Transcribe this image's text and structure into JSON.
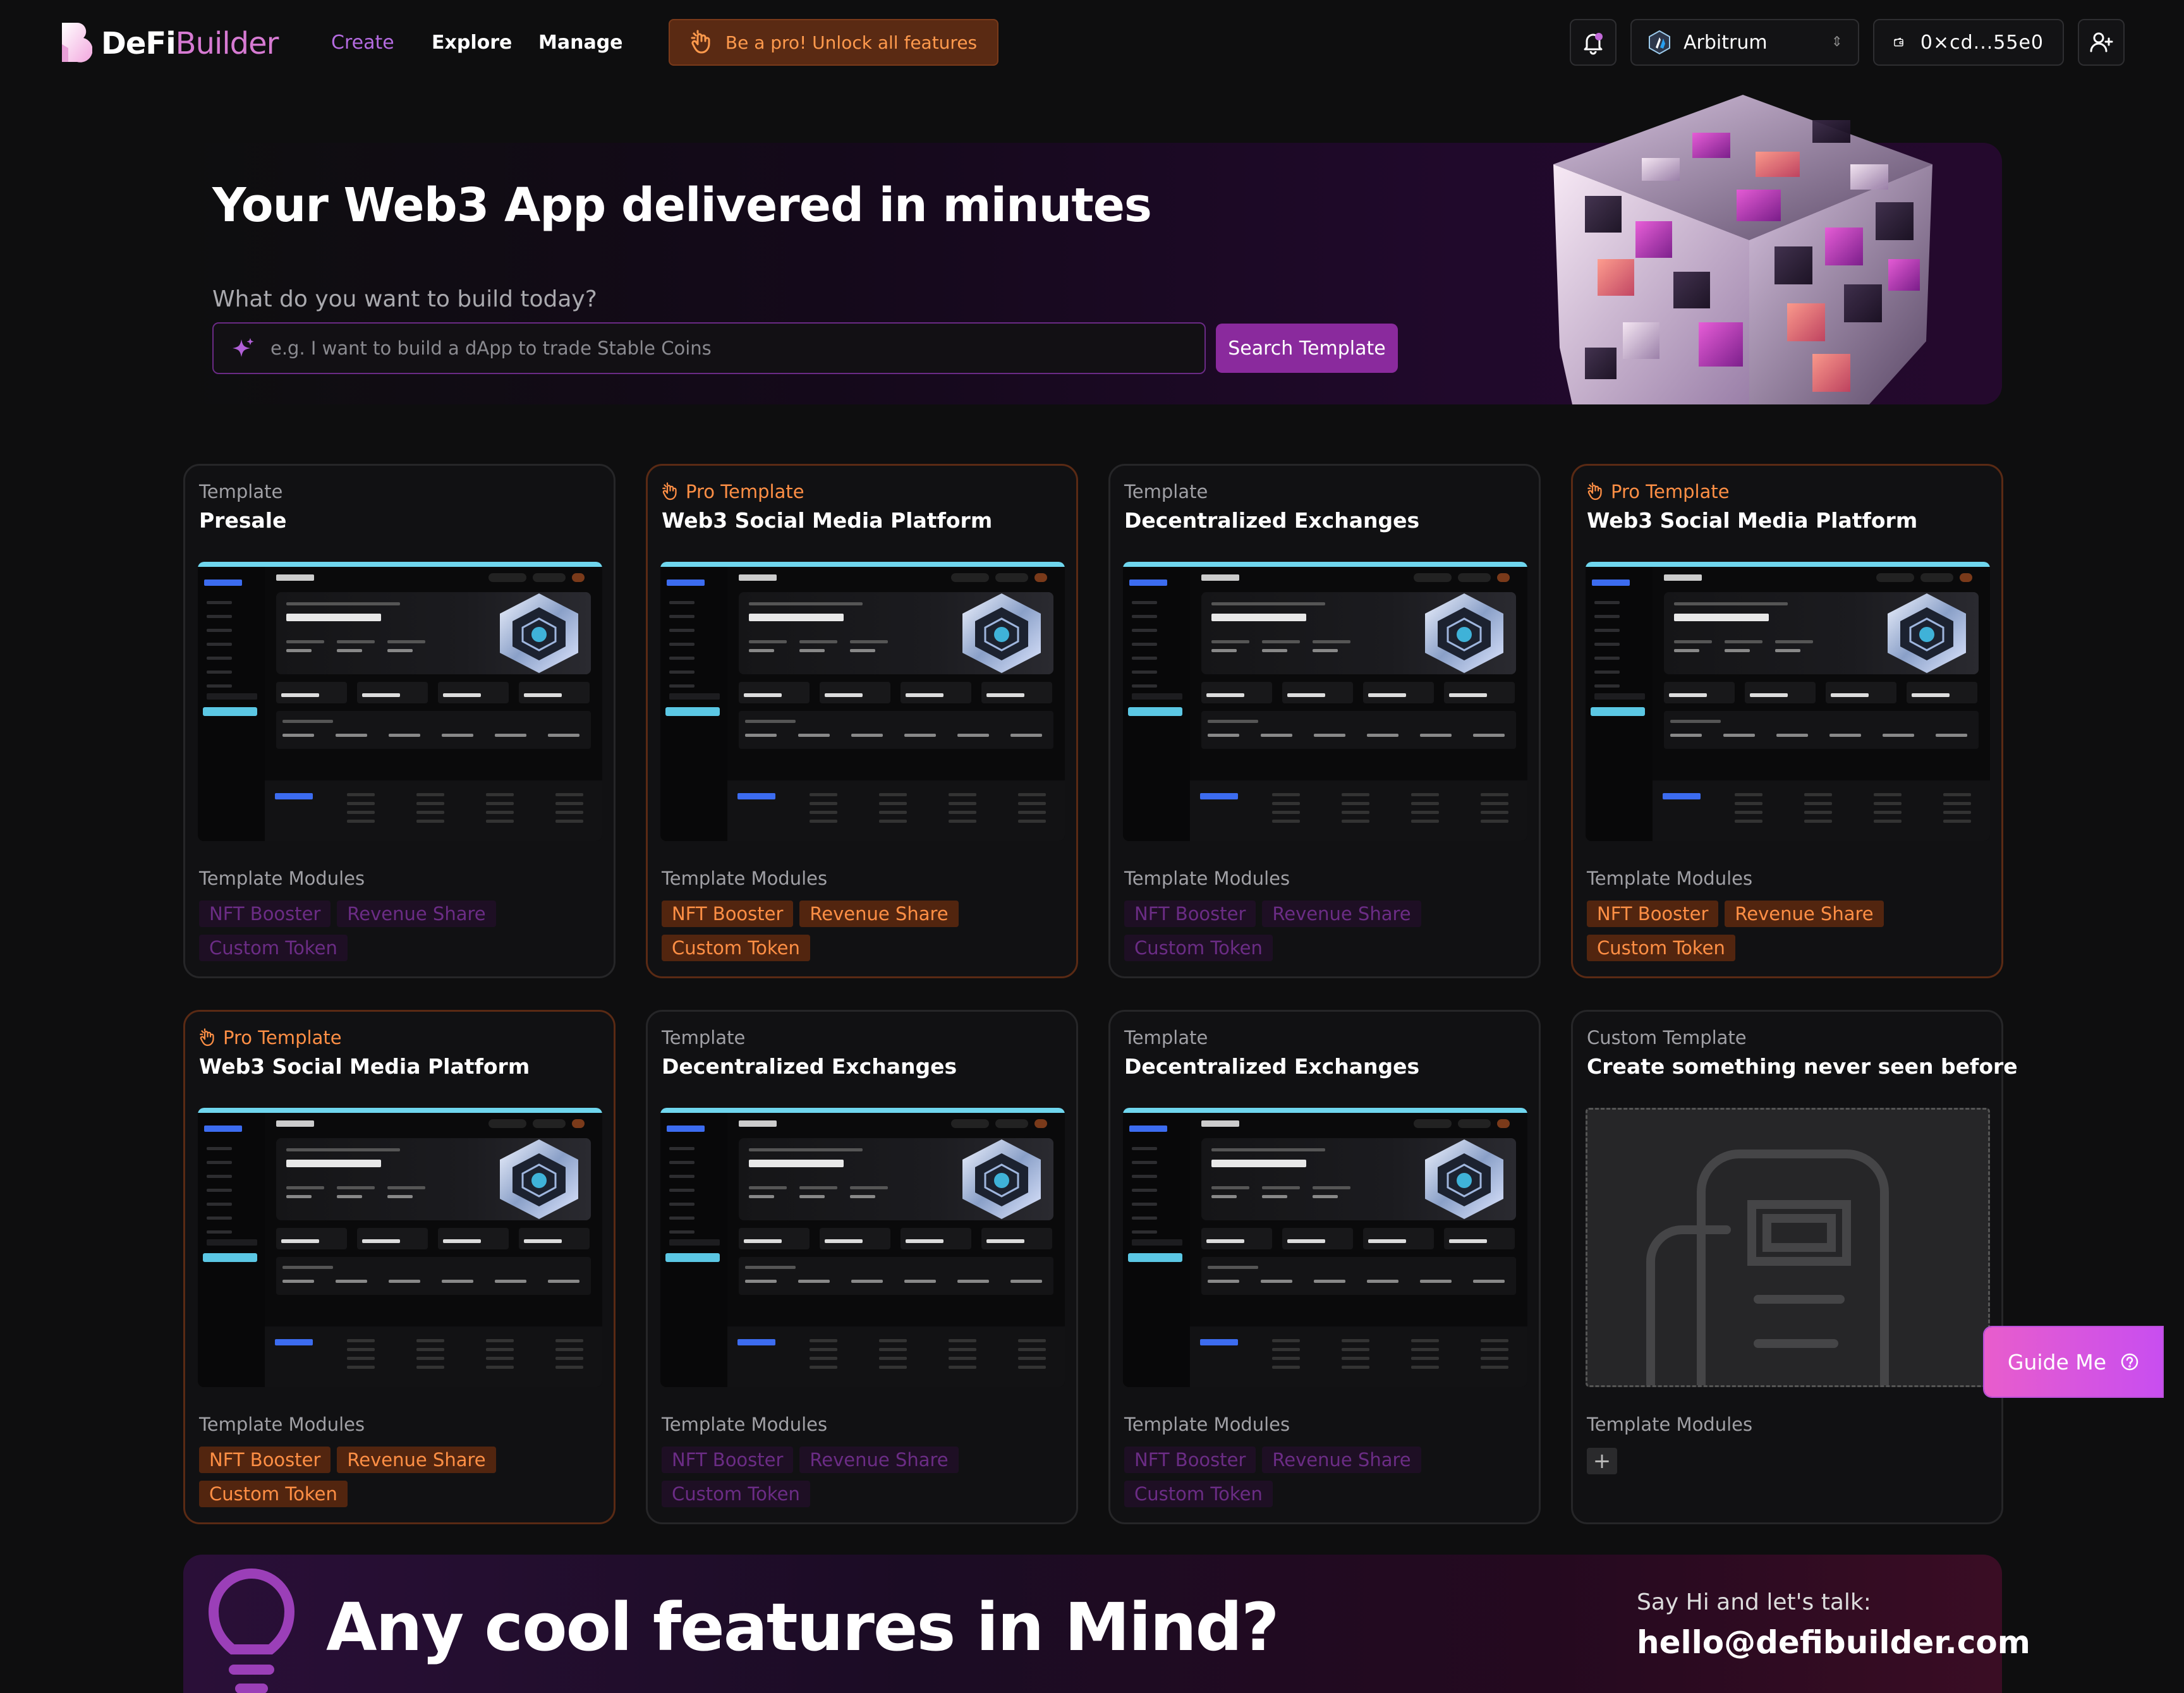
{
  "nav": {
    "logo_main": "DeFi",
    "logo_accent": "Builder",
    "links": [
      "Create",
      "Explore",
      "Manage"
    ],
    "pro_banner": "Be a pro! Unlock all features",
    "network": "Arbitrum",
    "wallet": "0×cd...55e0"
  },
  "hero": {
    "title": "Your Web3 App delivered in minutes",
    "subtitle": "What do you want to build today?",
    "search_placeholder": "e.g. I want to build a dApp to trade Stable Coins",
    "search_button": "Search Template"
  },
  "cards": [
    {
      "kind": "Template",
      "title": "Presale",
      "pro": false,
      "modules_label": "Template Modules",
      "tags": [
        "NFT Booster",
        "Revenue Share",
        "Custom Token"
      ]
    },
    {
      "kind": "Pro Template",
      "title": "Web3 Social Media Platform",
      "pro": true,
      "modules_label": "Template Modules",
      "tags": [
        "NFT Booster",
        "Revenue Share",
        "Custom Token"
      ]
    },
    {
      "kind": "Template",
      "title": "Decentralized Exchanges",
      "pro": false,
      "modules_label": "Template Modules",
      "tags": [
        "NFT Booster",
        "Revenue Share",
        "Custom Token"
      ]
    },
    {
      "kind": "Pro Template",
      "title": "Web3 Social Media Platform",
      "pro": true,
      "modules_label": "Template Modules",
      "tags": [
        "NFT Booster",
        "Revenue Share",
        "Custom Token"
      ]
    },
    {
      "kind": "Pro Template",
      "title": "Web3 Social Media Platform",
      "pro": true,
      "modules_label": "Template Modules",
      "tags": [
        "NFT Booster",
        "Revenue Share",
        "Custom Token"
      ]
    },
    {
      "kind": "Template",
      "title": "Decentralized Exchanges",
      "pro": false,
      "modules_label": "Template Modules",
      "tags": [
        "NFT Booster",
        "Revenue Share",
        "Custom Token"
      ]
    },
    {
      "kind": "Template",
      "title": "Decentralized Exchanges",
      "pro": false,
      "modules_label": "Template Modules",
      "tags": [
        "NFT Booster",
        "Revenue Share",
        "Custom Token"
      ]
    },
    {
      "kind": "Custom Template",
      "title": "Create something never seen before",
      "pro": false,
      "custom": true,
      "modules_label": "Template Modules",
      "tags": []
    }
  ],
  "banner": {
    "title": "Any cool features in Mind?",
    "say_hi": "Say Hi and let's talk:",
    "email": "hello@defibuilder.com"
  },
  "guide_button": "Guide Me",
  "icons": {
    "bell": "bell-icon",
    "network": "arbitrum-icon",
    "wallet": "wallet-icon",
    "user": "user-add-icon",
    "sparkle": "sparkle-icon",
    "hand": "hand-icon",
    "bulb": "lightbulb-icon",
    "help": "help-circle-icon"
  },
  "colors": {
    "accent_purple": "#8a2a9d",
    "pro_orange": "#ff8f45",
    "background": "#0e0e0f"
  }
}
